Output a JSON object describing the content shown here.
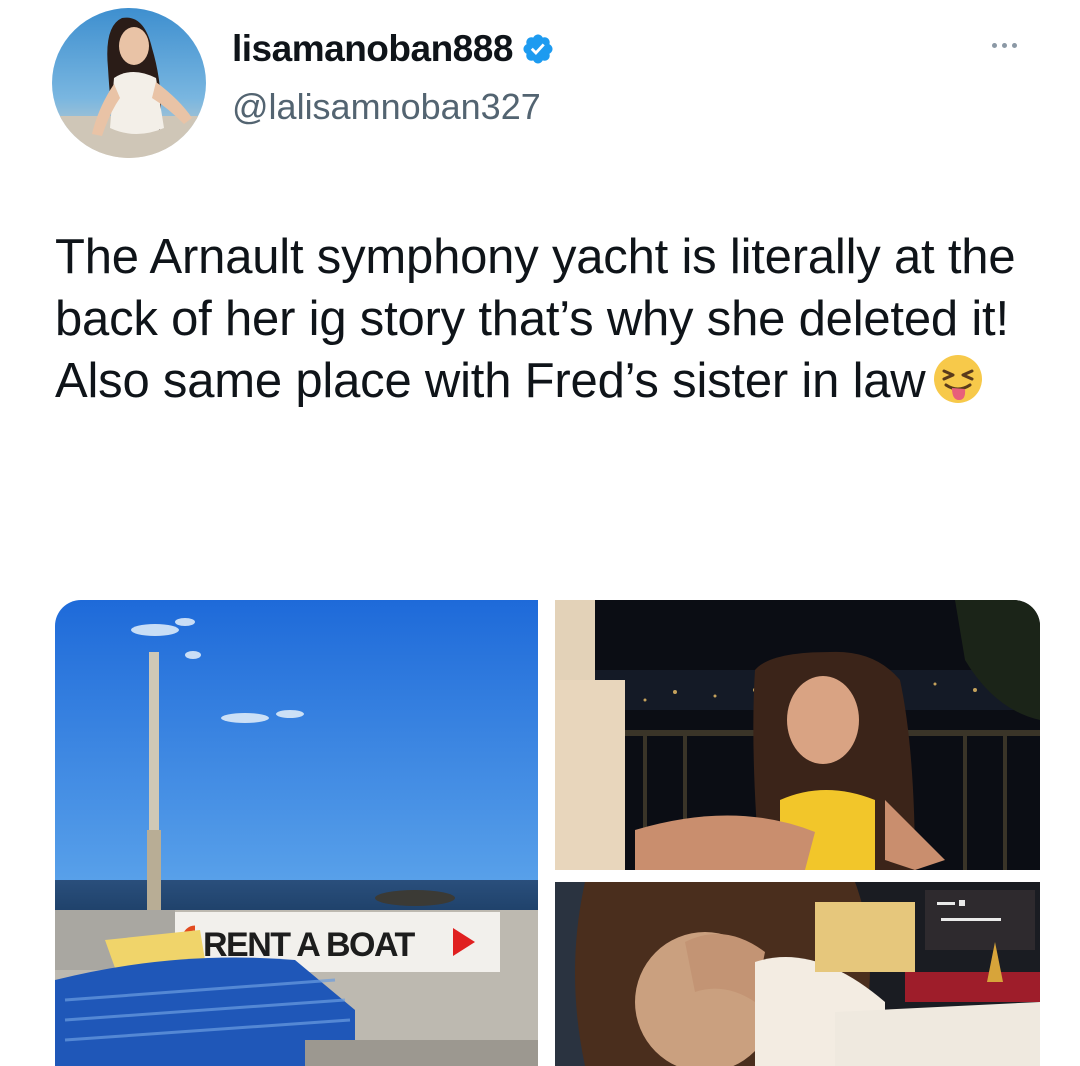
{
  "tweet": {
    "display_name": "lisamanoban888",
    "handle": "@lalisamnoban327",
    "text": "The Arnault symphony yacht is literally at the back of her ig story that’s why she deleted it! Also same place with Fred’s sister in law",
    "emoji": "squinting-face-with-tongue"
  },
  "media": {
    "sign_text": "RENT A BOAT"
  },
  "colors": {
    "verified": "#1d9bf0",
    "text": "#0f1419",
    "secondary": "#536471"
  },
  "icons": [
    "verified-badge-icon",
    "more-options-icon",
    "squinting-face-with-tongue-emoji"
  ]
}
